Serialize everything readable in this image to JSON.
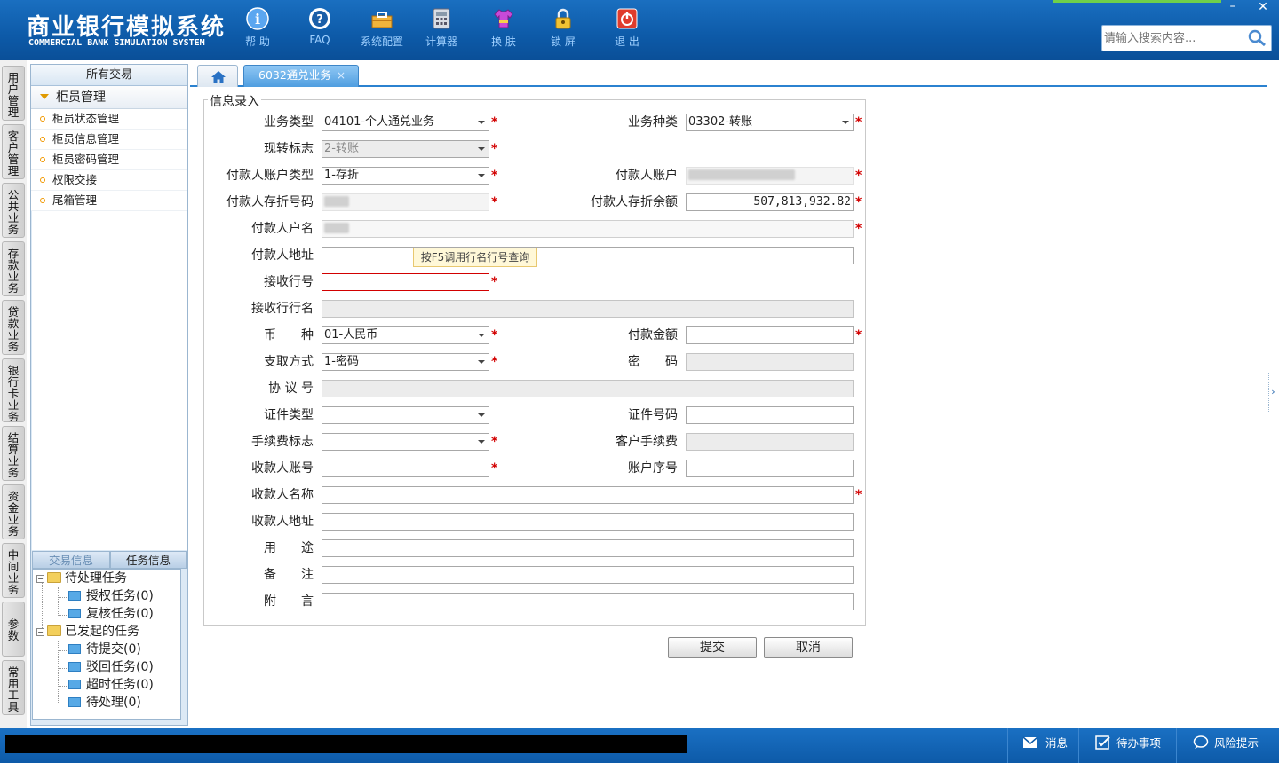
{
  "app": {
    "title": "商业银行模拟系统",
    "subtitle": "COMMERCIAL BANK SIMULATION SYSTEM"
  },
  "toolbar": [
    {
      "label": "帮 助",
      "icon": "help-icon"
    },
    {
      "label": "FAQ",
      "icon": "faq-icon"
    },
    {
      "label": "系统配置",
      "icon": "toolbox-icon"
    },
    {
      "label": "计算器",
      "icon": "calculator-icon"
    },
    {
      "label": "换 肤",
      "icon": "shirt-icon"
    },
    {
      "label": "锁 屏",
      "icon": "lock-icon"
    },
    {
      "label": "退 出",
      "icon": "power-icon"
    }
  ],
  "window": {
    "minimize": "–",
    "close": "✕"
  },
  "search": {
    "placeholder": "请输入搜索内容..."
  },
  "vtabs": [
    "用户管理",
    "客户管理",
    "公共业务",
    "存款业务",
    "贷款业务",
    "银行卡业务",
    "结算业务",
    "资金业务",
    "中间业务",
    "参数",
    "常用工具"
  ],
  "left_panel": {
    "header": "所有交易",
    "group": "柜员管理",
    "items": [
      "柜员状态管理",
      "柜员信息管理",
      "柜员密码管理",
      "权限交接",
      "尾箱管理"
    ],
    "bottom_tabs": [
      "交易信息",
      "任务信息"
    ],
    "tree": {
      "pending": "待处理任务",
      "auth": "授权任务(0)",
      "review": "复核任务(0)",
      "initiated": "已发起的任务",
      "to_submit": "待提交(0)",
      "rejected": "驳回任务(0)",
      "timeout": "超时任务(0)",
      "processing": "待处理(0)"
    }
  },
  "tabs": {
    "active": "6032通兑业务",
    "close": "×"
  },
  "form": {
    "legend": "信息录入",
    "labels": {
      "biz_type": "业务类型",
      "biz_kind": "业务种类",
      "cash_flag": "现转标志",
      "payer_acct_type": "付款人账户类型",
      "payer_acct": "付款人账户",
      "payer_book_no": "付款人存折号码",
      "payer_balance": "付款人存折余额",
      "payer_name": "付款人户名",
      "payer_addr": "付款人地址",
      "recv_bank_no": "接收行号",
      "recv_bank_name": "接收行行名",
      "currency": "币　　种",
      "amount": "付款金额",
      "withdraw": "支取方式",
      "password": "密　　码",
      "agreement": "协 议 号",
      "id_type": "证件类型",
      "id_no": "证件号码",
      "fee_flag": "手续费标志",
      "cust_fee": "客户手续费",
      "payee_acct": "收款人账号",
      "acct_seq": "账户序号",
      "payee_name": "收款人名称",
      "payee_addr": "收款人地址",
      "purpose": "用　　途",
      "remark": "备　　注",
      "postscript": "附　　言"
    },
    "values": {
      "biz_type": "04101-个人通兑业务",
      "biz_kind": "03302-转账",
      "cash_flag": "2-转账",
      "payer_acct_type": "1-存折",
      "payer_balance": "507,813,932.82",
      "currency": "01-人民币",
      "withdraw": "1-密码"
    },
    "required_mark": "*",
    "tooltip": "按F5调用行名行号查询"
  },
  "buttons": {
    "submit": "提交",
    "cancel": "取消"
  },
  "statusbar": {
    "messages": "消息",
    "todo": "待办事项",
    "risk": "风险提示"
  },
  "colors": {
    "header": "#0d5aa8",
    "accent": "#2b82d0",
    "required": "#d20000"
  }
}
